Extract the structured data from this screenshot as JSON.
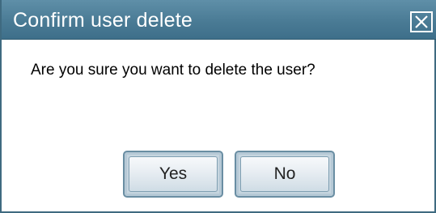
{
  "dialog": {
    "title": "Confirm user delete",
    "close_icon": "close-icon",
    "message": "Are you sure you want to delete the user?",
    "buttons": {
      "yes_label": "Yes",
      "no_label": "No"
    }
  },
  "colors": {
    "titlebar": "#4a7b95",
    "title_text": "#ffffff",
    "border": "#3f6a80",
    "button_border": "#6a8ea3"
  }
}
